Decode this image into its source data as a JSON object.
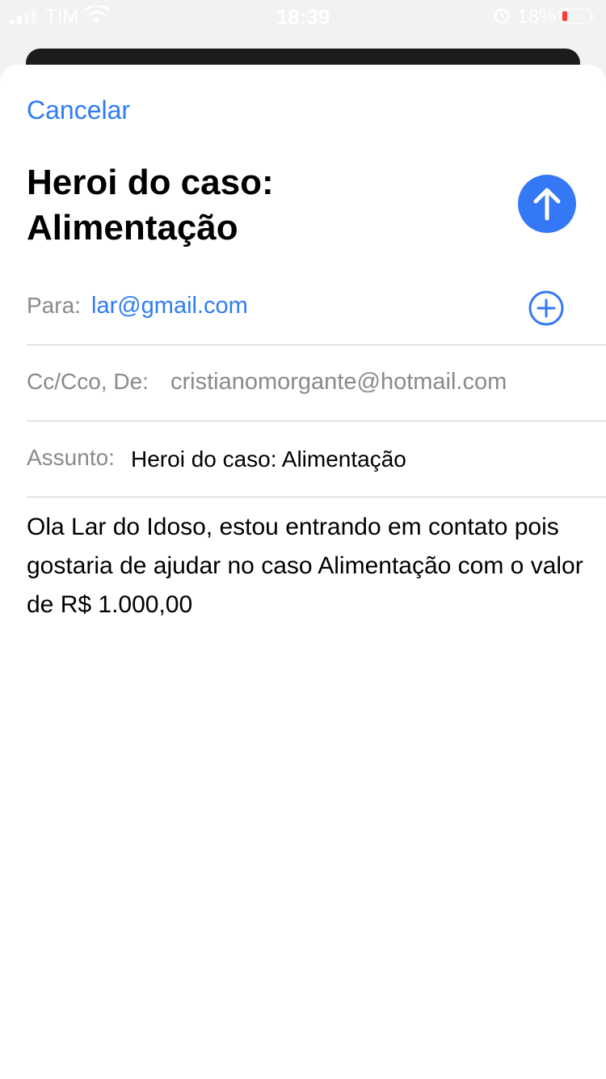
{
  "status_bar": {
    "carrier": "TIM",
    "time": "18:39",
    "battery_percent": "18%"
  },
  "compose": {
    "cancel_label": "Cancelar",
    "title": "Heroi do caso: Alimentação",
    "to": {
      "label": "Para:",
      "value": "lar@gmail.com"
    },
    "cc": {
      "label": "Cc/Cco, De:",
      "value": "cristianomorgante@hotmail.com"
    },
    "subject": {
      "label": "Assunto:",
      "value": "Heroi do caso: Alimentação"
    },
    "body": "Ola Lar do Idoso, estou entrando em contato pois gostaria de ajudar no caso Alimentação com o valor de R$ 1.000,00"
  },
  "colors": {
    "accent": "#3478f6",
    "label_gray": "#8a8a8e"
  },
  "icons": {
    "send": "arrow-up-icon",
    "add_contact": "plus-circle-icon"
  }
}
